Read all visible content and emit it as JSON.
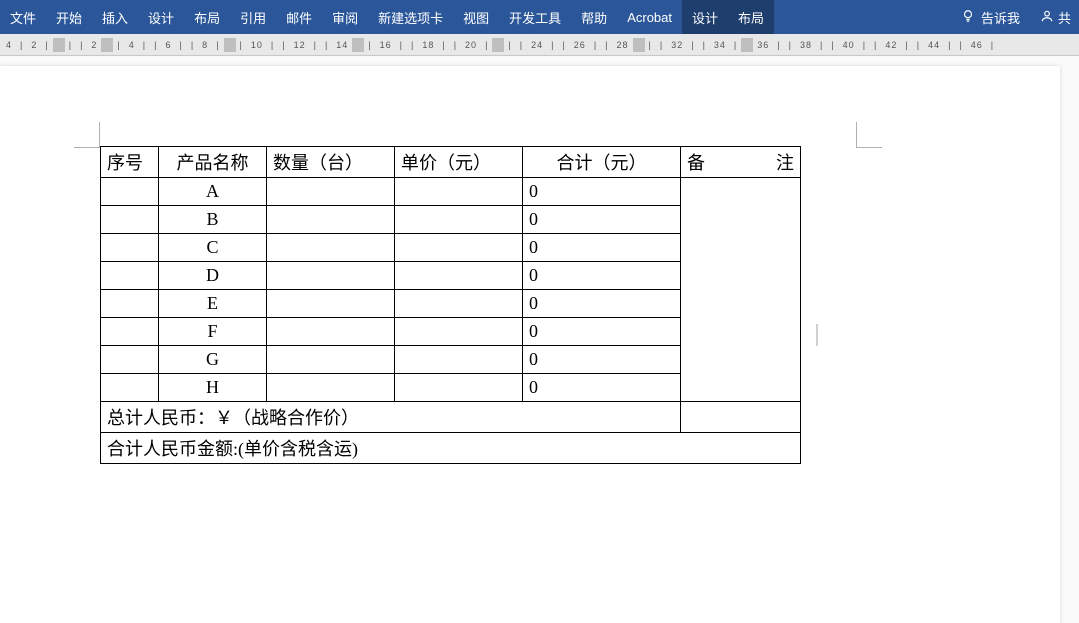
{
  "ribbon": {
    "tabs": [
      "文件",
      "开始",
      "插入",
      "设计",
      "布局",
      "引用",
      "邮件",
      "审阅",
      "新建选项卡",
      "视图",
      "开发工具",
      "帮助",
      "Acrobat",
      "设计",
      "布局"
    ],
    "active_indices": [
      13,
      14
    ],
    "tell_me": "告诉我",
    "share": "共"
  },
  "ruler": {
    "marks": [
      "4",
      "2",
      "",
      "",
      "2",
      "",
      "4",
      "6",
      "8",
      "",
      "10",
      "12",
      "14",
      "16",
      "",
      "18",
      "20",
      "",
      "",
      "24",
      "26",
      "28",
      "",
      "",
      "32",
      "34",
      "36",
      "",
      "38",
      "40",
      "42",
      "44",
      "46"
    ]
  },
  "table": {
    "headers": {
      "seq": "序号",
      "name": "产品名称",
      "qty": "数量（台）",
      "price": "单价（元）",
      "total": "合计（元）",
      "remark": "备注"
    },
    "rows": [
      {
        "seq": "",
        "name": "A",
        "qty": "",
        "price": "",
        "total": "0"
      },
      {
        "seq": "",
        "name": "B",
        "qty": "",
        "price": "",
        "total": "0"
      },
      {
        "seq": "",
        "name": "C",
        "qty": "",
        "price": "",
        "total": "0"
      },
      {
        "seq": "",
        "name": "D",
        "qty": "",
        "price": "",
        "total": "0"
      },
      {
        "seq": "",
        "name": "E",
        "qty": "",
        "price": "",
        "total": "0"
      },
      {
        "seq": "",
        "name": "F",
        "qty": "",
        "price": "",
        "total": "0"
      },
      {
        "seq": "",
        "name": "G",
        "qty": "",
        "price": "",
        "total": "0"
      },
      {
        "seq": "",
        "name": "H",
        "qty": "",
        "price": "",
        "total": "0"
      }
    ],
    "footer1": "总计人民币：￥（战略合作价）",
    "footer2": "合计人民币金额:(单价含税含运)"
  }
}
